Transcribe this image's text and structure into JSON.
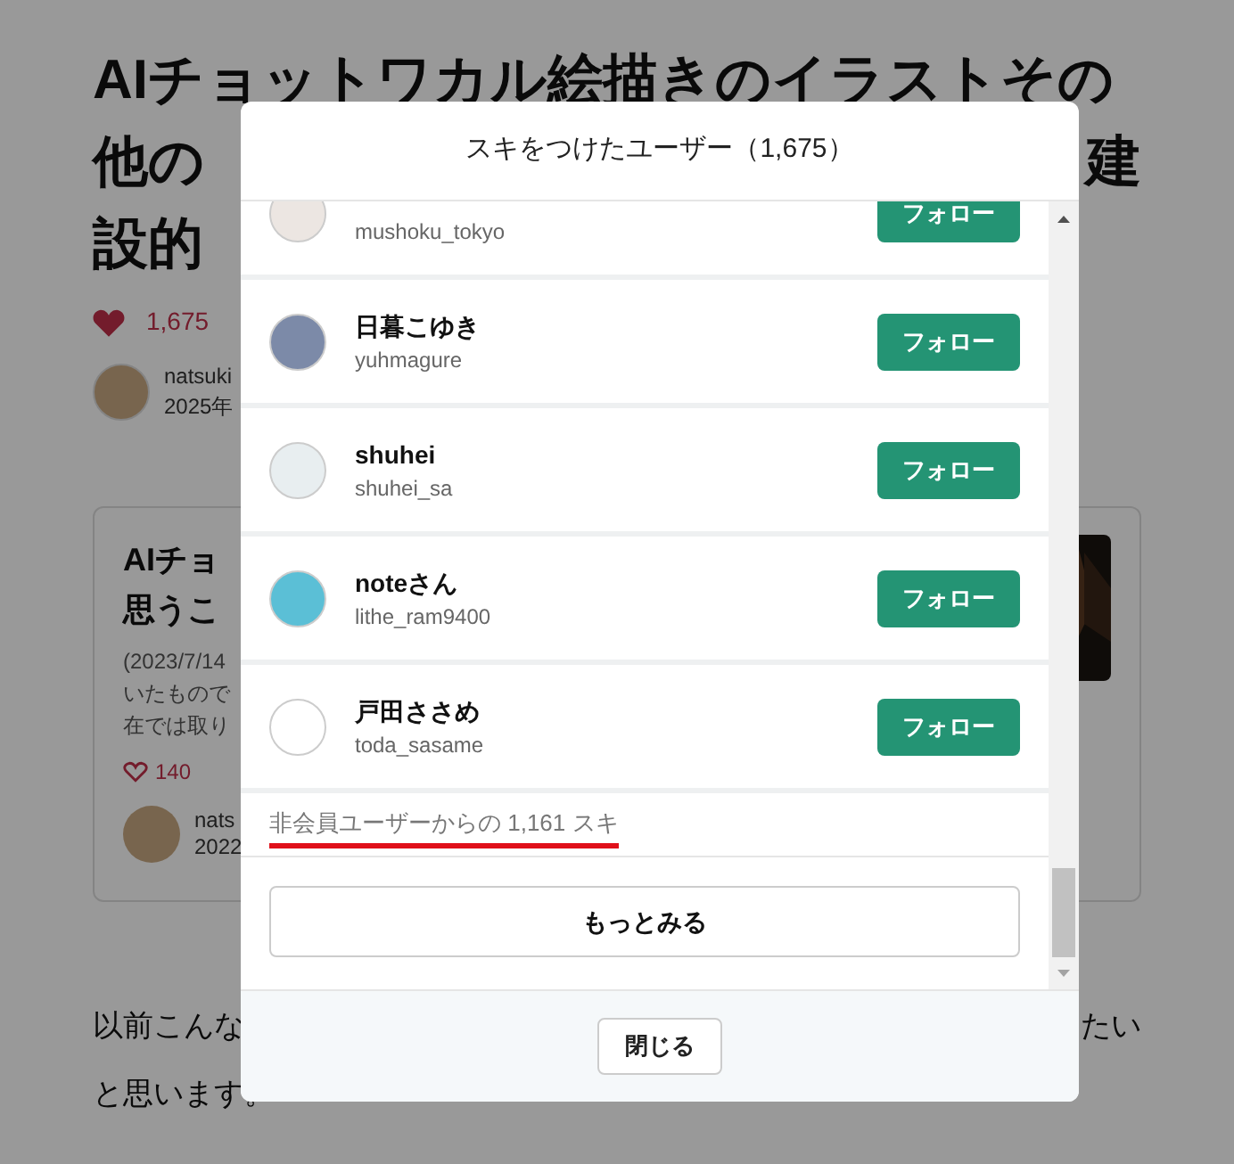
{
  "article": {
    "title_line_1": "AIチョットワカル絵描きのイラストその",
    "title_line_2_left": "他の",
    "title_line_2_right": "建",
    "title_line_3": "設的",
    "likes": "1,675",
    "author": "natsuki",
    "date": "2025年",
    "embed": {
      "title_left_1": "AIチョ",
      "title_left_2": "思うこ",
      "excerpt": [
        "(2023/7/14",
        "いたもので",
        "在では取り"
      ],
      "likes": "140",
      "author": "nats",
      "date": "2022"
    },
    "body_left": "以前こんな",
    "body_right": "たい",
    "body_line_2": "と思います。"
  },
  "modal": {
    "title": "スキをつけたユーザー（1,675）",
    "users": [
      {
        "handle": "mushoku_tokyo",
        "button": "フォロー"
      },
      {
        "name": "日暮こゆき",
        "handle": "yuhmagure",
        "button": "フォロー"
      },
      {
        "name": "shuhei",
        "handle": "shuhei_sa",
        "button": "フォロー"
      },
      {
        "name": "noteさん",
        "handle": "lithe_ram9400",
        "button": "フォロー"
      },
      {
        "name": "戸田ささめ",
        "handle": "toda_sasame",
        "button": "フォロー"
      }
    ],
    "guest_likes": "非会員ユーザーからの 1,161 スキ",
    "more_button": "もっとみる",
    "close_button": "閉じる"
  }
}
